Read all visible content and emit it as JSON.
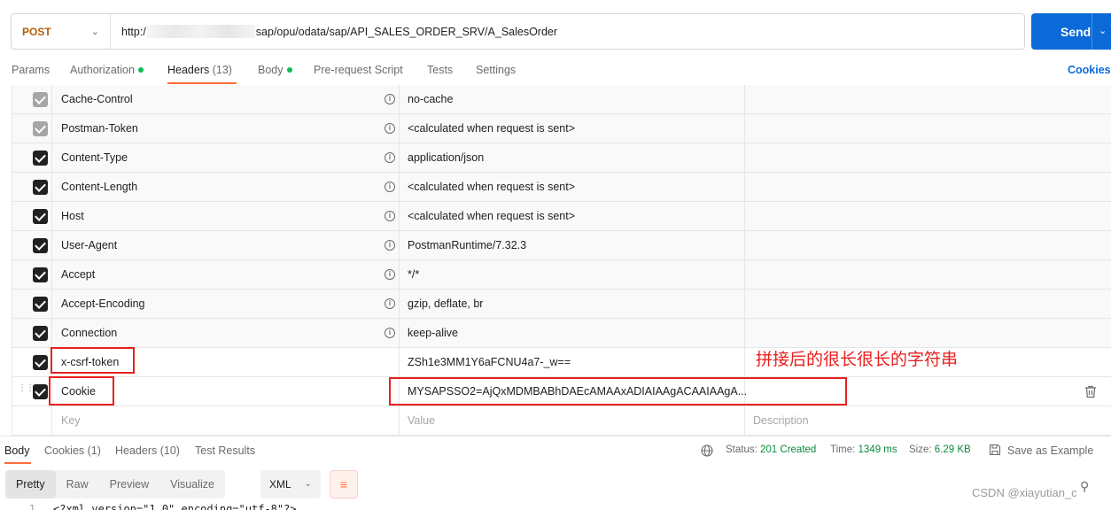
{
  "request": {
    "method": "POST",
    "url_prefix": "http:/",
    "url_suffix": "sap/opu/odata/sap/API_SALES_ORDER_SRV/A_SalesOrder",
    "send_label": "Send"
  },
  "request_tabs": [
    {
      "label": "Params"
    },
    {
      "label": "Authorization"
    },
    {
      "label": "Headers",
      "count": "(13)"
    },
    {
      "label": "Body"
    },
    {
      "label": "Pre-request Script"
    },
    {
      "label": "Tests"
    },
    {
      "label": "Settings"
    }
  ],
  "cookies_label": "Cookies",
  "headers": [
    {
      "key": "Cache-Control",
      "value": "no-cache",
      "checked": "grey"
    },
    {
      "key": "Postman-Token",
      "value": "<calculated when request is sent>",
      "checked": "grey"
    },
    {
      "key": "Content-Type",
      "value": "application/json",
      "checked": "dark"
    },
    {
      "key": "Content-Length",
      "value": "<calculated when request is sent>",
      "checked": "dark"
    },
    {
      "key": "Host",
      "value": "<calculated when request is sent>",
      "checked": "dark"
    },
    {
      "key": "User-Agent",
      "value": "PostmanRuntime/7.32.3",
      "checked": "dark"
    },
    {
      "key": "Accept",
      "value": "*/*",
      "checked": "dark"
    },
    {
      "key": "Accept-Encoding",
      "value": "gzip, deflate, br",
      "checked": "dark"
    },
    {
      "key": "Connection",
      "value": "keep-alive",
      "checked": "dark"
    },
    {
      "key": "x-csrf-token",
      "value": "ZSh1e3MM1Y6aFCNU4a7-_w==",
      "checked": "dark"
    },
    {
      "key": "Cookie",
      "value": "MYSAPSSO2=AjQxMDMBABhDAEcAMAAxADIAIAAgACAAIAAgA...",
      "checked": "dark"
    }
  ],
  "placeholders": {
    "key": "Key",
    "value": "Value",
    "description": "Description"
  },
  "annotation": "拼接后的很长很长的字符串",
  "response_tabs": [
    {
      "label": "Body"
    },
    {
      "label": "Cookies (1)"
    },
    {
      "label": "Headers (10)"
    },
    {
      "label": "Test Results"
    }
  ],
  "response_status": {
    "status_label": "Status:",
    "status_value": "201 Created",
    "time_label": "Time:",
    "time_value": "1349 ms",
    "size_label": "Size:",
    "size_value": "6.29 KB",
    "save_label": "Save as Example"
  },
  "view_modes": [
    "Pretty",
    "Raw",
    "Preview",
    "Visualize"
  ],
  "format": "XML",
  "code_line": {
    "number": "1",
    "text": "<?xml version=\"1.0\" encoding=\"utf-8\"?>"
  },
  "watermark": "CSDN @xiayutian_c"
}
